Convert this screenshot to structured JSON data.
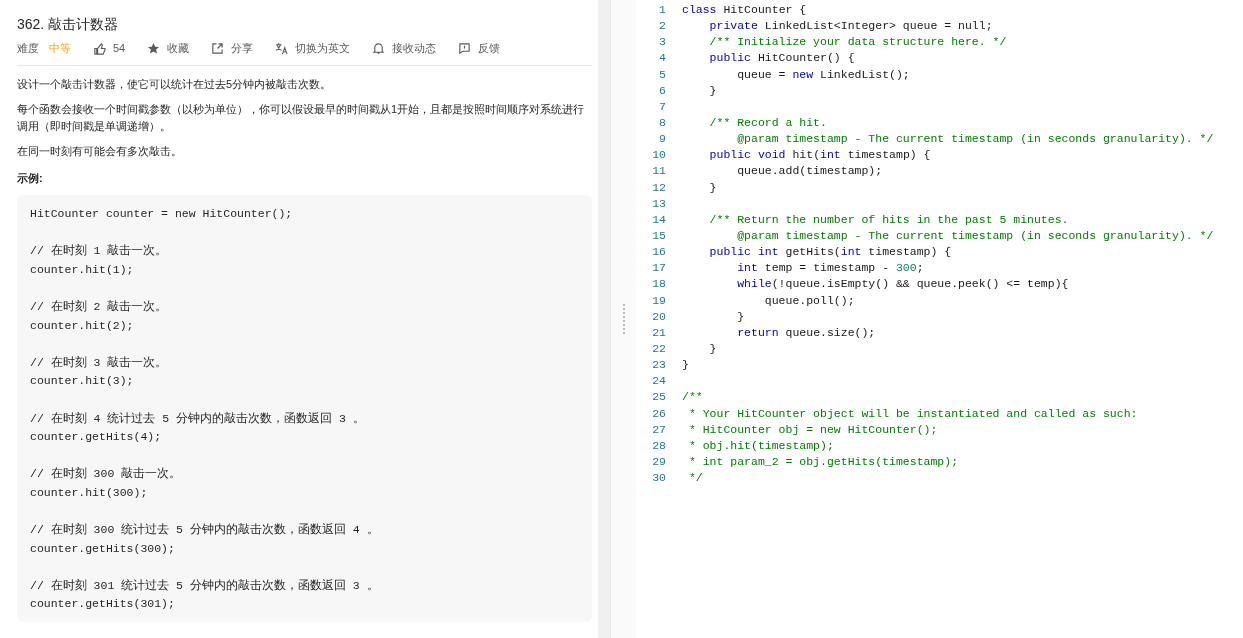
{
  "problem": {
    "title": "362. 敲击计数器",
    "difficulty_label": "难度",
    "difficulty": "中等",
    "actions": [
      {
        "kind": "like",
        "label": "54"
      },
      {
        "kind": "star",
        "label": "收藏"
      },
      {
        "kind": "share",
        "label": "分享"
      },
      {
        "kind": "translate",
        "label": "切换为英文"
      },
      {
        "kind": "bell",
        "label": "接收动态"
      },
      {
        "kind": "feedback",
        "label": "反馈"
      }
    ],
    "paragraphs": [
      "设计一个敲击计数器，使它可以统计在过去5分钟内被敲击次数。",
      "每个函数会接收一个时间戳参数（以秒为单位），你可以假设最早的时间戳从1开始，且都是按照时间顺序对系统进行调用（即时间戳是单调递增）。",
      "在同一时刻有可能会有多次敲击。"
    ],
    "example_heading": "示例:",
    "example_code": "HitCounter counter = new HitCounter();\n\n// 在时刻 1 敲击一次。\ncounter.hit(1);\n\n// 在时刻 2 敲击一次。\ncounter.hit(2);\n\n// 在时刻 3 敲击一次。\ncounter.hit(3);\n\n// 在时刻 4 统计过去 5 分钟内的敲击次数，函数返回 3 。\ncounter.getHits(4);\n\n// 在时刻 300 敲击一次。\ncounter.hit(300);\n\n// 在时刻 300 统计过去 5 分钟内的敲击次数，函数返回 4 。\ncounter.getHits(300);\n\n// 在时刻 301 统计过去 5 分钟内的敲击次数，函数返回 3 。\ncounter.getHits(301);"
  },
  "editor": {
    "lines": [
      {
        "number": "1",
        "tokens": [
          {
            "kind": "keyword",
            "text": "class"
          },
          {
            "kind": "plain",
            "text": " HitCounter {"
          }
        ]
      },
      {
        "number": "2",
        "tokens": [
          {
            "kind": "keyword",
            "text": "    private"
          },
          {
            "kind": "plain",
            "text": " LinkedList<Integer> queue = null;"
          }
        ]
      },
      {
        "number": "3",
        "tokens": [
          {
            "kind": "comment",
            "text": "    /** Initialize your data structure here. */"
          }
        ]
      },
      {
        "number": "4",
        "tokens": [
          {
            "kind": "keyword",
            "text": "    public"
          },
          {
            "kind": "plain",
            "text": " HitCounter() {"
          }
        ]
      },
      {
        "number": "5",
        "tokens": [
          {
            "kind": "plain",
            "text": "        queue = "
          },
          {
            "kind": "keyword",
            "text": "new"
          },
          {
            "kind": "plain",
            "text": " LinkedList();"
          }
        ]
      },
      {
        "number": "6",
        "tokens": [
          {
            "kind": "plain",
            "text": "    }"
          }
        ]
      },
      {
        "number": "7"
      },
      {
        "number": "8",
        "tokens": [
          {
            "kind": "comment",
            "text": "    /** Record a hit."
          }
        ]
      },
      {
        "number": "9",
        "tokens": [
          {
            "kind": "comment",
            "text": "        @param timestamp - The current timestamp (in seconds granularity). */"
          }
        ]
      },
      {
        "number": "10",
        "tokens": [
          {
            "kind": "keyword",
            "text": "    public void"
          },
          {
            "kind": "plain",
            "text": " hit("
          },
          {
            "kind": "keyword",
            "text": "int"
          },
          {
            "kind": "plain",
            "text": " timestamp) {"
          }
        ]
      },
      {
        "number": "11",
        "tokens": [
          {
            "kind": "plain",
            "text": "        queue.add(timestamp);"
          }
        ]
      },
      {
        "number": "12",
        "tokens": [
          {
            "kind": "plain",
            "text": "    }"
          }
        ]
      },
      {
        "number": "13"
      },
      {
        "number": "14",
        "tokens": [
          {
            "kind": "comment",
            "text": "    /** Return the number of hits in the past 5 minutes."
          }
        ]
      },
      {
        "number": "15",
        "tokens": [
          {
            "kind": "comment",
            "text": "        @param timestamp - The current timestamp (in seconds granularity). */"
          }
        ]
      },
      {
        "number": "16",
        "tokens": [
          {
            "kind": "keyword",
            "text": "    public int"
          },
          {
            "kind": "plain",
            "text": " getHits("
          },
          {
            "kind": "keyword",
            "text": "int"
          },
          {
            "kind": "plain",
            "text": " timestamp) {"
          }
        ]
      },
      {
        "number": "17",
        "tokens": [
          {
            "kind": "keyword",
            "text": "        int"
          },
          {
            "kind": "plain",
            "text": " temp = timestamp - "
          },
          {
            "kind": "number",
            "text": "300"
          },
          {
            "kind": "plain",
            "text": ";"
          }
        ]
      },
      {
        "number": "18",
        "tokens": [
          {
            "kind": "keyword",
            "text": "        while"
          },
          {
            "kind": "plain",
            "text": "(!queue.isEmpty() && queue.peek() <= temp){"
          }
        ]
      },
      {
        "number": "19",
        "tokens": [
          {
            "kind": "plain",
            "text": "            queue.poll();"
          }
        ]
      },
      {
        "number": "20",
        "tokens": [
          {
            "kind": "plain",
            "text": "        }"
          }
        ]
      },
      {
        "number": "21",
        "tokens": [
          {
            "kind": "keyword",
            "text": "        return"
          },
          {
            "kind": "plain",
            "text": " queue.size();"
          }
        ]
      },
      {
        "number": "22",
        "tokens": [
          {
            "kind": "plain",
            "text": "    }"
          }
        ]
      },
      {
        "number": "23",
        "tokens": [
          {
            "kind": "plain",
            "text": "}"
          }
        ]
      },
      {
        "number": "24"
      },
      {
        "number": "25",
        "tokens": [
          {
            "kind": "comment",
            "text": "/**"
          }
        ]
      },
      {
        "number": "26",
        "tokens": [
          {
            "kind": "comment",
            "text": " * Your HitCounter object will be instantiated and called as such:"
          }
        ]
      },
      {
        "number": "27",
        "tokens": [
          {
            "kind": "comment",
            "text": " * HitCounter obj = new HitCounter();"
          }
        ]
      },
      {
        "number": "28",
        "tokens": [
          {
            "kind": "comment",
            "text": " * obj.hit(timestamp);"
          }
        ]
      },
      {
        "number": "29",
        "tokens": [
          {
            "kind": "comment",
            "text": " * int param_2 = obj.getHits(timestamp);"
          }
        ]
      },
      {
        "number": "30",
        "tokens": [
          {
            "kind": "comment",
            "text": " */"
          }
        ]
      }
    ]
  }
}
